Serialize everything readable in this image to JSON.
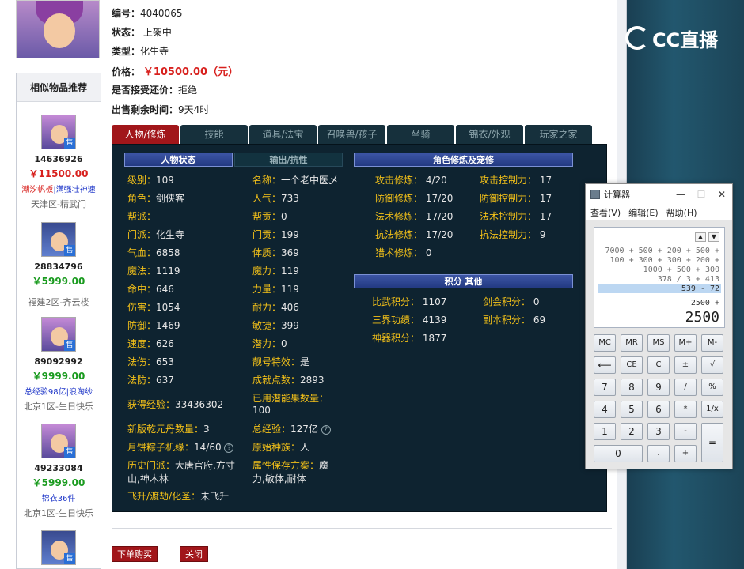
{
  "info": {
    "id_label": "编号：",
    "id_value": "4040065",
    "status_label": "状态：",
    "status_value": "上架中",
    "type_label": "类型：",
    "type_value": "化生寺",
    "price_label": "价格：",
    "price_value": "￥10500.00（元）",
    "bargain_label": "是否接受还价：",
    "bargain_value": "拒绝",
    "remain_label": "出售剩余时间：",
    "remain_value": "9天4时"
  },
  "sidebar": {
    "title": "相似物品推荐",
    "items": [
      {
        "id": "14636926",
        "price": "￥11500.00",
        "tag1": "潮汐帆板",
        "sep": "|",
        "tag2": "满强壮神速",
        "server": "天津区-精武门",
        "badge": "售"
      },
      {
        "id": "28834796",
        "price": "￥5999.00",
        "server": "福建2区-齐云楼",
        "badge": "售"
      },
      {
        "id": "89092992",
        "price": "￥9999.00",
        "tag1": "总经验98亿",
        "sep": "|",
        "tag2": "浪淘纱",
        "server": "北京1区-生日快乐",
        "badge": "售"
      },
      {
        "id": "49233084",
        "price": "￥5999.00",
        "tag1": "锦衣36件",
        "server": "北京1区-生日快乐",
        "badge": "售"
      },
      {
        "badge": "售"
      }
    ]
  },
  "tabs": [
    "人物/修炼",
    "技能",
    "道具/法宝",
    "召唤兽/孩子",
    "坐骑",
    "锦衣/外观",
    "玩家之家"
  ],
  "panel": {
    "head_status": "人物状态",
    "head_output": "输出/抗性",
    "head_cultivate": "角色修炼及宠修",
    "head_points": "积分 其他",
    "col1": [
      {
        "k": "级别：",
        "v": "109"
      },
      {
        "k": "角色：",
        "v": "剑侠客"
      },
      {
        "k": "帮派：",
        "v": ""
      },
      {
        "k": "门派：",
        "v": "化生寺"
      },
      {
        "k": "气血：",
        "v": "6858"
      },
      {
        "k": "魔法：",
        "v": "1119"
      },
      {
        "k": "命中：",
        "v": "646"
      },
      {
        "k": "伤害：",
        "v": "1054"
      },
      {
        "k": "防御：",
        "v": "1469"
      },
      {
        "k": "速度：",
        "v": "626"
      },
      {
        "k": "法伤：",
        "v": "653"
      },
      {
        "k": "法防：",
        "v": "637"
      }
    ],
    "col2": [
      {
        "k": "名称：",
        "v": "一个老中医乄"
      },
      {
        "k": "人气：",
        "v": "733"
      },
      {
        "k": "帮贡：",
        "v": "0"
      },
      {
        "k": "门贡：",
        "v": "199"
      },
      {
        "k": "体质：",
        "v": "369"
      },
      {
        "k": "魔力：",
        "v": "119"
      },
      {
        "k": "力量：",
        "v": "119"
      },
      {
        "k": "耐力：",
        "v": "406"
      },
      {
        "k": "敏捷：",
        "v": "399"
      },
      {
        "k": "潜力：",
        "v": "0"
      },
      {
        "k": "靓号特效：",
        "v": "是"
      },
      {
        "k": "成就点数：",
        "v": "2893"
      }
    ],
    "exp_k": "获得经验：",
    "exp_v": "33436302",
    "used_k": "已用潜能果数量：",
    "used_v": "100",
    "qk_k": "新版乾元丹数量：",
    "qk_v": "3",
    "total_k": "总经验：",
    "total_v": "127亿",
    "moon_k": "月饼粽子机缘：",
    "moon_v": "14/60",
    "race_k": "原始种族：",
    "race_v": "人",
    "hist_k": "历史门派：",
    "hist_v1": "大唐官府,方寸",
    "hist_v2": "山,神木林",
    "attr_k": "属性保存方案：",
    "attr_v1": "魔",
    "attr_v2": "力,敏体,耐体",
    "fly_k": "飞升/渡劫/化圣：",
    "fly_v": "未飞升",
    "cult": [
      {
        "k": "攻击修炼：",
        "v": "4/20",
        "k2": "攻击控制力：",
        "v2": "17"
      },
      {
        "k": "防御修炼：",
        "v": "17/20",
        "k2": "防御控制力：",
        "v2": "17"
      },
      {
        "k": "法术修炼：",
        "v": "17/20",
        "k2": "法术控制力：",
        "v2": "17"
      },
      {
        "k": "抗法修炼：",
        "v": "17/20",
        "k2": "抗法控制力：",
        "v2": "9"
      },
      {
        "k": "猎术修炼：",
        "v": "0"
      }
    ],
    "points": [
      {
        "k": "比武积分：",
        "v": "1107",
        "k2": "剑会积分：",
        "v2": "0"
      },
      {
        "k": "三界功绩：",
        "v": "4139",
        "k2": "副本积分：",
        "v2": "69"
      },
      {
        "k": "神器积分：",
        "v": "1877"
      }
    ]
  },
  "buttons": {
    "buy": "下单购买",
    "close": "关闭"
  },
  "logo": {
    "text": "CC直播"
  },
  "calculator": {
    "title": "计算器",
    "menu": [
      "查看(V)",
      "编辑(E)",
      "帮助(H)"
    ],
    "history": [
      "7000 + 500 + 200 + 500 +",
      "100 + 300 + 300 + 200 +",
      "1000 + 500 + 300",
      "378 / 3 + 413",
      "539 - 72"
    ],
    "expression": "2500 +",
    "result": "2500",
    "keys": [
      [
        "MC",
        "MR",
        "MS",
        "M+",
        "M-"
      ],
      [
        "⟵",
        "CE",
        "C",
        "±",
        "√"
      ],
      [
        "7",
        "8",
        "9",
        "/",
        "%"
      ],
      [
        "4",
        "5",
        "6",
        "*",
        "1/x"
      ],
      [
        "1",
        "2",
        "3",
        "-",
        "="
      ],
      [
        "0",
        ".",
        "+"
      ]
    ]
  }
}
